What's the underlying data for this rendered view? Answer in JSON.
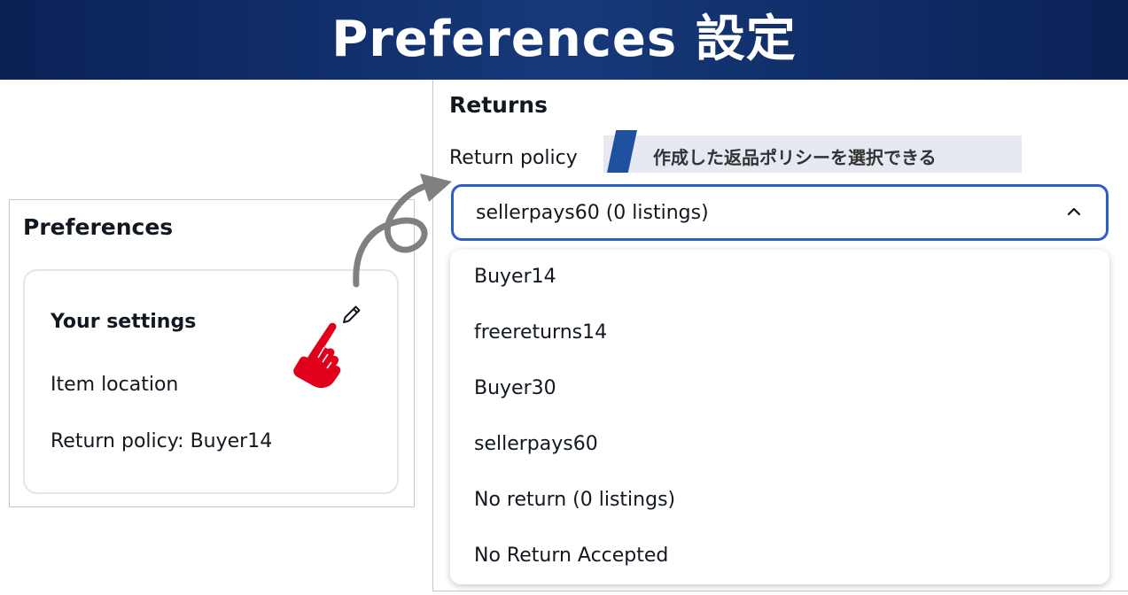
{
  "banner": {
    "title": "Preferences 設定"
  },
  "preferences": {
    "title": "Preferences",
    "your_settings_title": "Your settings",
    "item_location": "Item location",
    "return_policy_summary": "Return policy: Buyer14",
    "edit_icon": "pencil-icon"
  },
  "returns": {
    "title": "Returns",
    "return_policy_label": "Return policy",
    "annotation": "作成した返品ポリシーを選択できる",
    "selected_value": "sellerpays60 (0 listings)",
    "options": [
      {
        "label": "Buyer14"
      },
      {
        "label": "freereturns14"
      },
      {
        "label": "Buyer30"
      },
      {
        "label": "sellerpays60"
      },
      {
        "label": "No return (0 listings)"
      },
      {
        "label": "No Return Accepted"
      }
    ]
  },
  "colors": {
    "banner": "#0a2155",
    "focus_border": "#2b5fc7",
    "annotation_bg": "#e6e8f2",
    "annotation_accent": "#1f4f9f",
    "pointer_hand": "#e0001b",
    "arrow": "#808080"
  }
}
